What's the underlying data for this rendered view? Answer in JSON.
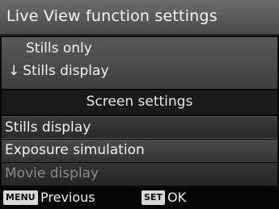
{
  "title": "Live View function settings",
  "mode": {
    "option1": "Stills only",
    "option2_marker": "↓",
    "option2": "Stills display"
  },
  "section": "Screen settings",
  "rows": [
    {
      "label": "Stills display"
    },
    {
      "label": "Exposure simulation"
    },
    {
      "label": "Movie display"
    }
  ],
  "footer": {
    "menu_key": "MENU",
    "previous": "Previous",
    "set_key": "SET",
    "ok": "OK"
  }
}
